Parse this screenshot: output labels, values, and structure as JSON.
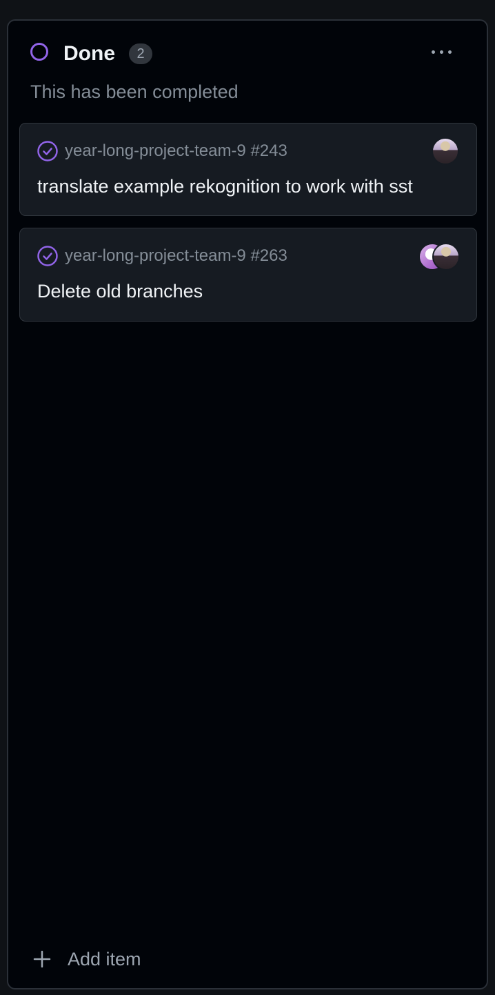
{
  "column": {
    "title": "Done",
    "count": "2",
    "description": "This has been completed",
    "status_color": "#9164e8",
    "more_icon": "kebab-horizontal-icon"
  },
  "cards": [
    {
      "repo_ref": "year-long-project-team-9 #243",
      "title": "translate example rekognition to work with sst",
      "status_icon": "issue-closed-check-icon",
      "assignees": [
        "avatar"
      ]
    },
    {
      "repo_ref": "year-long-project-team-9 #263",
      "title": "Delete old branches",
      "status_icon": "issue-closed-check-icon",
      "assignees": [
        "avatar",
        "avatar"
      ]
    }
  ],
  "footer": {
    "add_label": "Add item",
    "add_icon": "plus-icon"
  }
}
